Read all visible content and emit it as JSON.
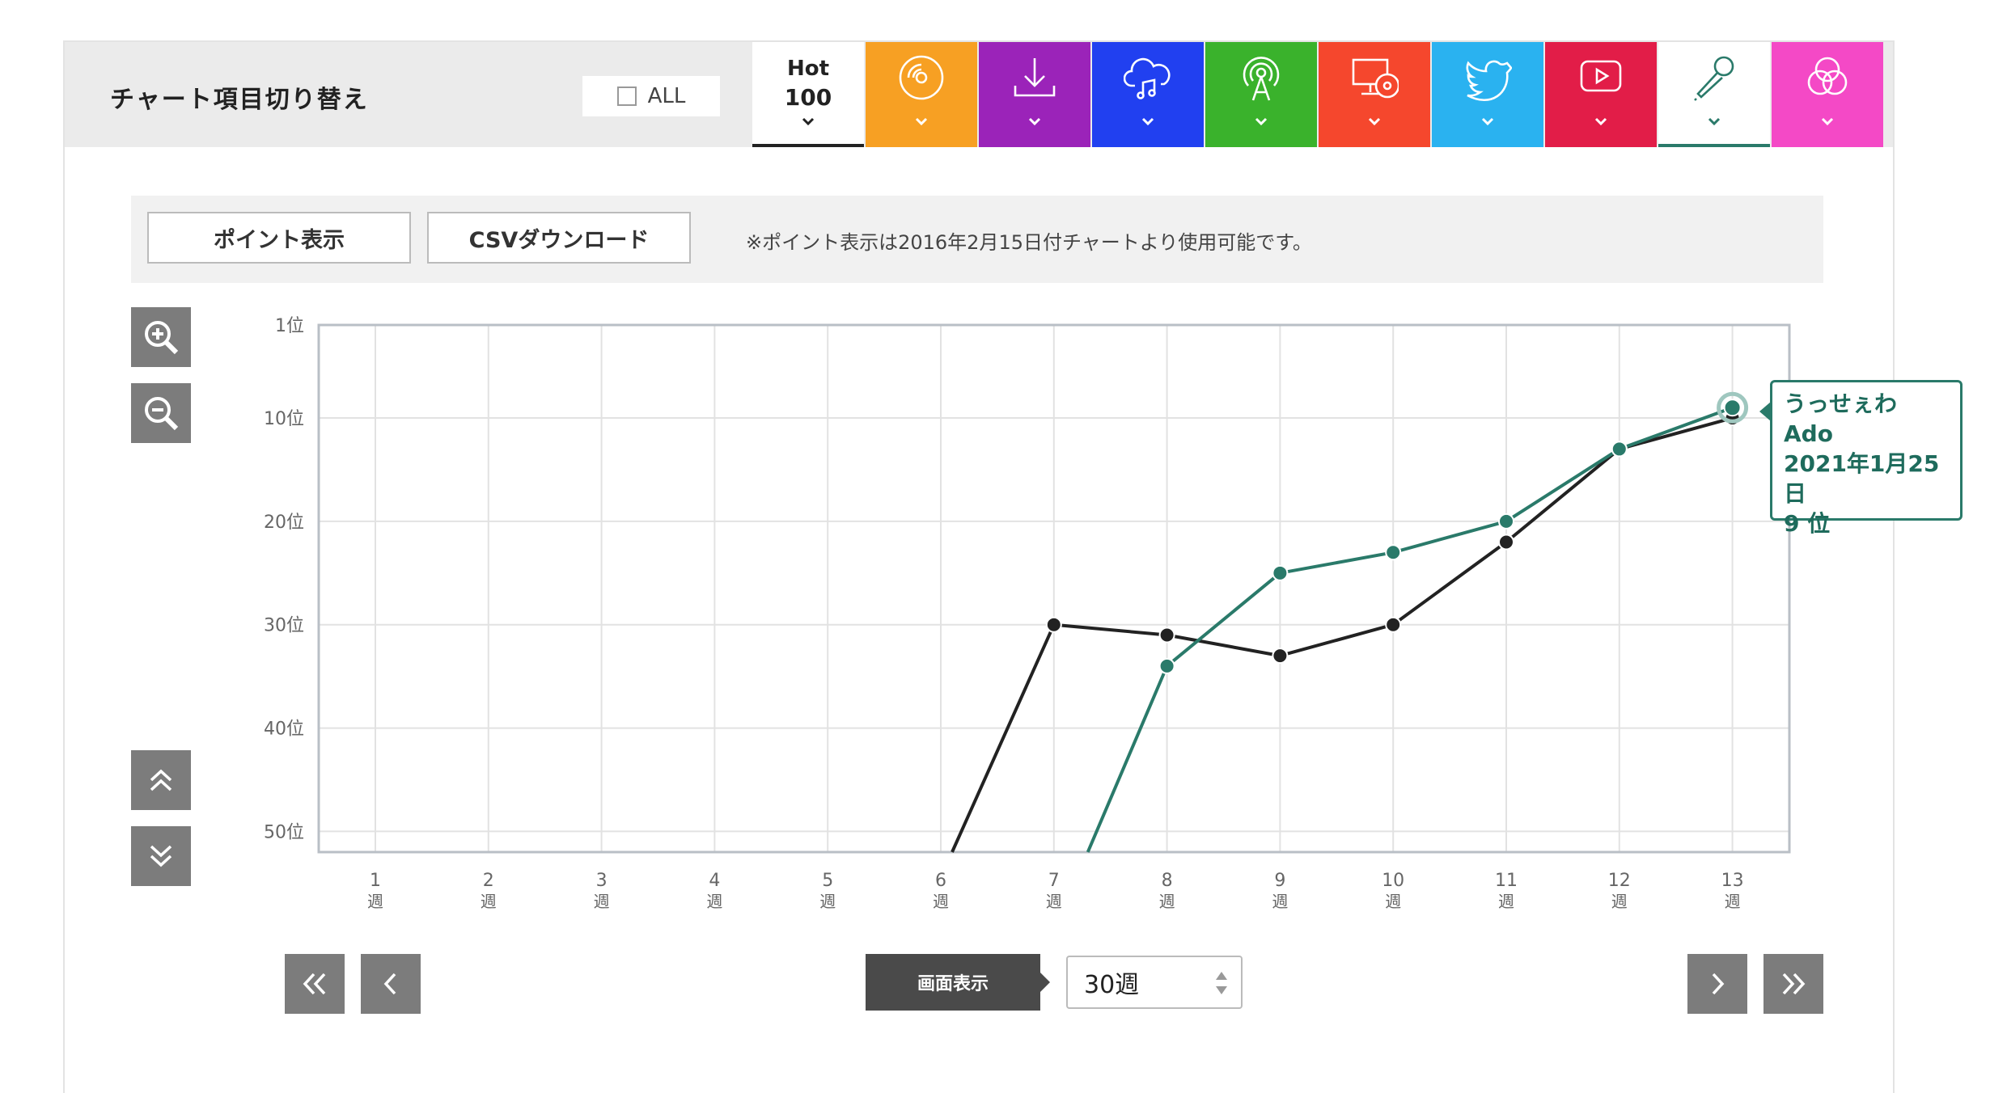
{
  "header": {
    "title": "チャート項目切り替え",
    "all_label": "ALL",
    "hot_line1": "Hot",
    "hot_line2": "100"
  },
  "tabs": [
    {
      "id": "hot100",
      "icon": "chevron-down-icon",
      "color": "#ffffff"
    },
    {
      "id": "physical",
      "icon": "disc-icon",
      "color": "#f7a023"
    },
    {
      "id": "download",
      "icon": "download-icon",
      "color": "#9b23b9"
    },
    {
      "id": "streaming",
      "icon": "cloud-music-icon",
      "color": "#2140f0"
    },
    {
      "id": "radio",
      "icon": "broadcast-icon",
      "color": "#3ab22c"
    },
    {
      "id": "lookup",
      "icon": "computer-disc-icon",
      "color": "#f5472d"
    },
    {
      "id": "twitter",
      "icon": "bird-icon",
      "color": "#2ab2f0"
    },
    {
      "id": "video",
      "icon": "play-icon",
      "color": "#e21d48"
    },
    {
      "id": "karaoke",
      "icon": "microphone-icon",
      "color": "#ffffff"
    },
    {
      "id": "combined",
      "icon": "circles-icon",
      "color": "#f449c6"
    }
  ],
  "toolbar": {
    "point_button": "ポイント表示",
    "csv_button": "CSVダウンロード",
    "note": "※ポイント表示は2016年2月15日付チャートより使用可能です。"
  },
  "footer": {
    "screen_label": "画面表示",
    "weeks_value": "30週"
  },
  "tooltip": {
    "title": "うっせぇわ",
    "artist": "Ado",
    "date": "2021年1月25日",
    "rank": "9 位"
  },
  "chart_data": {
    "type": "line",
    "x": [
      1,
      2,
      3,
      4,
      5,
      6,
      7,
      8,
      9,
      10,
      11,
      12,
      13
    ],
    "x_tick_labels": [
      "1",
      "2",
      "3",
      "4",
      "5",
      "6",
      "7",
      "8",
      "9",
      "10",
      "11",
      "12",
      "13"
    ],
    "x_unit": "週",
    "y_ticks": [
      1,
      10,
      20,
      30,
      40,
      50
    ],
    "y_tick_labels": [
      "1位",
      "10位",
      "20位",
      "30位",
      "40位",
      "50位"
    ],
    "ylim": [
      1,
      52
    ],
    "y_inverted": true,
    "grid": true,
    "series": [
      {
        "color": "#222222",
        "values": [
          null,
          null,
          null,
          null,
          null,
          null,
          30,
          31,
          33,
          30,
          22,
          13,
          10
        ],
        "enters_from_x": 6.1
      },
      {
        "color": "#2a7a6a",
        "values": [
          null,
          null,
          null,
          null,
          null,
          null,
          null,
          34,
          25,
          23,
          20,
          13,
          9
        ],
        "enters_from_x": 7.3
      }
    ]
  }
}
